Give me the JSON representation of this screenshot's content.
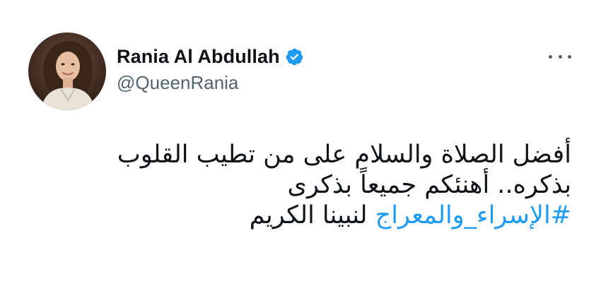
{
  "user": {
    "display_name": "Rania Al Abdullah",
    "handle": "@QueenRania",
    "verified": true,
    "avatar_icon": "profile-photo",
    "verified_icon": "verified-badge-icon"
  },
  "menu": {
    "icon": "more-horizontal-icon"
  },
  "tweet": {
    "line1": "أفضل الصلاة والسلام على من تطيب القلوب",
    "line2": "بذكره.. أهنئكم جميعاً بذكرى",
    "hashtag": "#الإسراء_والمعراج",
    "line3_rest": " لنبينا الكريم"
  },
  "colors": {
    "text": "#0f1419",
    "secondary": "#536471",
    "accent": "#1d9bf0",
    "background": "#ffffff"
  }
}
